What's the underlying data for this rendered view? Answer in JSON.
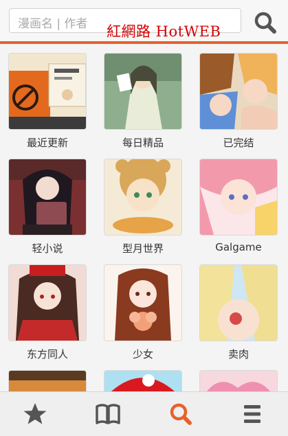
{
  "search": {
    "placeholder": "漫画名 | 作者",
    "button_icon": "search-icon"
  },
  "watermark": "紅網路 HotWEB",
  "colors": {
    "accent": "#e8602c",
    "icon_gray": "#555555",
    "active_tab": "#e8602c"
  },
  "categories": [
    {
      "label": "最近更新"
    },
    {
      "label": "每日精品"
    },
    {
      "label": "已完结"
    },
    {
      "label": "轻小说"
    },
    {
      "label": "型月世界"
    },
    {
      "label": "Galgame"
    },
    {
      "label": "东方同人"
    },
    {
      "label": "少女"
    },
    {
      "label": "卖肉"
    }
  ],
  "tabbar": [
    {
      "icon": "star-icon",
      "active": false
    },
    {
      "icon": "book-icon",
      "active": false
    },
    {
      "icon": "search-icon",
      "active": true
    },
    {
      "icon": "menu-icon",
      "active": false
    }
  ]
}
